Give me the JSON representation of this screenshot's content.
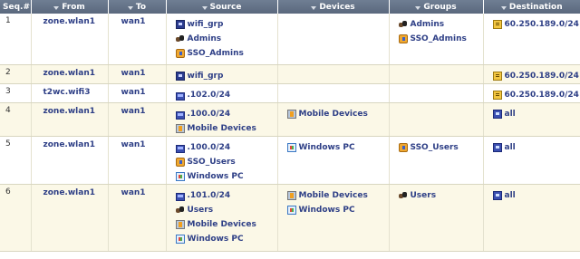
{
  "columns": {
    "seq": "Seq.#",
    "from": "From",
    "to": "To",
    "source": "Source",
    "devices": "Devices",
    "groups": "Groups",
    "destination": "Destination"
  },
  "rows": [
    {
      "seq": "1",
      "from": "zone.wlan1",
      "to": "wan1",
      "source": [
        {
          "icon": "address-group-icon",
          "label": "wifi_grp"
        },
        {
          "icon": "user-group-icon",
          "label": "Admins"
        },
        {
          "icon": "sso-group-icon",
          "label": "SSO_Admins"
        }
      ],
      "devices": [],
      "groups": [
        {
          "icon": "user-group-icon",
          "label": "Admins"
        },
        {
          "icon": "sso-group-icon",
          "label": "SSO_Admins"
        }
      ],
      "destination": [
        {
          "icon": "destination-address-icon",
          "label": "60.250.189.0/24"
        }
      ]
    },
    {
      "seq": "2",
      "from": "zone.wlan1",
      "to": "wan1",
      "source": [
        {
          "icon": "address-group-icon",
          "label": "wifi_grp"
        }
      ],
      "devices": [],
      "groups": [],
      "destination": [
        {
          "icon": "destination-address-icon",
          "label": "60.250.189.0/24"
        }
      ]
    },
    {
      "seq": "3",
      "from": "t2wc.wifi3",
      "to": "wan1",
      "source": [
        {
          "icon": "address-icon",
          "label": ".102.0/24"
        }
      ],
      "devices": [],
      "groups": [],
      "destination": [
        {
          "icon": "destination-address-icon",
          "label": "60.250.189.0/24"
        }
      ]
    },
    {
      "seq": "4",
      "from": "zone.wlan1",
      "to": "wan1",
      "source": [
        {
          "icon": "address-icon",
          "label": ".100.0/24"
        },
        {
          "icon": "mobile-devices-icon",
          "label": "Mobile Devices"
        }
      ],
      "devices": [
        {
          "icon": "mobile-devices-icon",
          "label": "Mobile Devices"
        }
      ],
      "groups": [],
      "destination": [
        {
          "icon": "all-address-icon",
          "label": "all"
        }
      ]
    },
    {
      "seq": "5",
      "from": "zone.wlan1",
      "to": "wan1",
      "source": [
        {
          "icon": "address-icon",
          "label": ".100.0/24"
        },
        {
          "icon": "sso-group-icon",
          "label": "SSO_Users"
        },
        {
          "icon": "windows-pc-icon",
          "label": "Windows PC"
        }
      ],
      "devices": [
        {
          "icon": "windows-pc-icon",
          "label": "Windows PC"
        }
      ],
      "groups": [
        {
          "icon": "sso-group-icon",
          "label": "SSO_Users"
        }
      ],
      "destination": [
        {
          "icon": "all-address-icon",
          "label": "all"
        }
      ]
    },
    {
      "seq": "6",
      "from": "zone.wlan1",
      "to": "wan1",
      "source": [
        {
          "icon": "address-icon",
          "label": ".101.0/24"
        },
        {
          "icon": "user-group-icon",
          "label": "Users"
        },
        {
          "icon": "mobile-devices-icon",
          "label": "Mobile Devices"
        },
        {
          "icon": "windows-pc-icon",
          "label": "Windows PC"
        }
      ],
      "devices": [
        {
          "icon": "mobile-devices-icon",
          "label": "Mobile Devices"
        },
        {
          "icon": "windows-pc-icon",
          "label": "Windows PC"
        }
      ],
      "groups": [
        {
          "icon": "user-group-icon",
          "label": "Users"
        }
      ],
      "destination": [
        {
          "icon": "all-address-icon",
          "label": "all"
        }
      ]
    }
  ]
}
